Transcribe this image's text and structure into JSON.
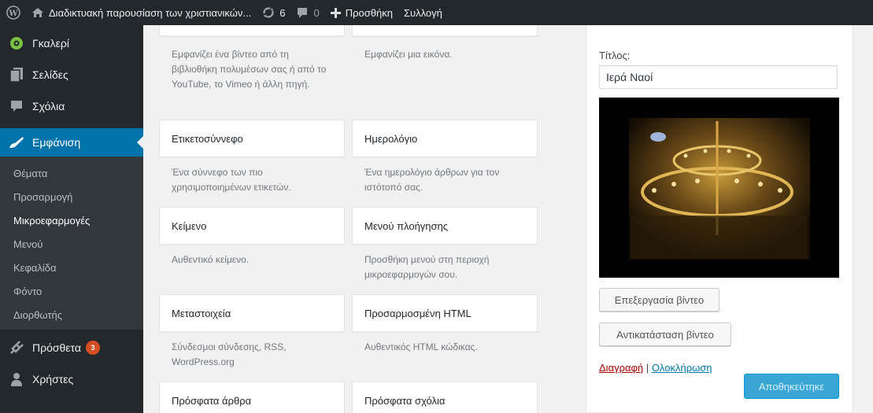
{
  "adminbar": {
    "site_title": "Διαδικτυακή παρουσίαση των χριστιανικών...",
    "updates_count": "6",
    "comments_count": "0",
    "new_label": "Προσθήκη",
    "customize_label": "Συλλογή"
  },
  "sidebar": {
    "items": [
      {
        "label": "Γκαλερί",
        "icon": "gallery-icon"
      },
      {
        "label": "Σελίδες",
        "icon": "pages-icon"
      },
      {
        "label": "Σχόλια",
        "icon": "comments-icon"
      },
      {
        "label": "Εμφάνιση",
        "icon": "appearance-icon"
      }
    ],
    "submenu": [
      "Θέματα",
      "Προσαρμογή",
      "Μικροεφαρμογές",
      "Μενού",
      "Κεφαλίδα",
      "Φόντο",
      "Διορθωτής"
    ],
    "plugins_label": "Πρόσθετα",
    "plugins_badge": "3",
    "users_label": "Χρήστες"
  },
  "widgets": {
    "top_desc_left": "Εμφανίζει ένα βίντεο από τη βιβλιοθήκη πολυμέσων σας ή από το YouTube, το Vimeo ή άλλη πηγή.",
    "top_desc_right": "Εμφανίζει μια εικόνα.",
    "rows": [
      {
        "left_title": "Ετικετοσύννεφο",
        "left_desc": "Ένα σύννεφο των πιο χρησιμοποιημένων ετικετών.",
        "right_title": "Ημερολόγιο",
        "right_desc": "Ένα ημερολόγιο άρθρων για τον ιστότοπό σας."
      },
      {
        "left_title": "Κείμενο",
        "left_desc": "Αυθεντικό κείμενο.",
        "right_title": "Μενού πλοήγησης",
        "right_desc": "Προσθήκη μενού στη περιοχή μικροεφαρμογών σου."
      },
      {
        "left_title": "Μεταστοιχεία",
        "left_desc": "Σύνδεσμοι σύνδεσης, RSS, WordPress.org",
        "right_title": "Προσαρμοσμένη HTML",
        "right_desc": "Αυθεντικός HTML κώδικας."
      },
      {
        "left_title": "Πρόσφατα άρθρα",
        "left_desc": "",
        "right_title": "Πρόσφατα σχόλια",
        "right_desc": ""
      }
    ]
  },
  "panel": {
    "title_label": "Τίτλος:",
    "title_value": "Ιερά Ναοί",
    "edit_video": "Επεξεργασία βίντεο",
    "replace_video": "Αντικατάσταση βίντεο",
    "delete_link": "Διαγραφή",
    "separator": "|",
    "done_link": "Ολοκλήρωση",
    "save_button": "Αποθηκεύτηκε"
  },
  "colors": {
    "admin_dark": "#23282d",
    "accent_blue": "#0073aa",
    "badge_orange": "#d54e21",
    "save_blue": "#39a6d6"
  }
}
